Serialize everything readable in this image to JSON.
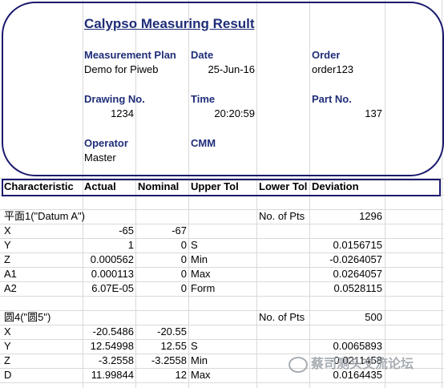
{
  "title": "Calypso Measuring Result",
  "header": {
    "measurement_plan_label": "Measurement Plan",
    "measurement_plan_value": "Demo for Piweb",
    "date_label": "Date",
    "date_value": "25-Jun-16",
    "order_label": "Order",
    "order_value": "order123",
    "drawing_no_label": "Drawing No.",
    "drawing_no_value": "1234",
    "time_label": "Time",
    "time_value": "20:20:59",
    "part_no_label": "Part No.",
    "part_no_value": "137",
    "operator_label": "Operator",
    "operator_value": "Master",
    "cmm_label": "CMM"
  },
  "columns": [
    "Characteristic",
    "Actual",
    "Nominal",
    "Upper Tol",
    "Lower Tol",
    "Deviation"
  ],
  "group1": {
    "name": "平面1(\"Datum A\")",
    "pts_label": "No. of Pts",
    "pts_value": "1296",
    "rows": [
      {
        "c": "X",
        "a": "-65",
        "n": "-67",
        "u": "",
        "d": ""
      },
      {
        "c": "Y",
        "a": "1",
        "n": "0",
        "u": "S",
        "d": "0.0156715"
      },
      {
        "c": "Z",
        "a": "0.000562",
        "n": "0",
        "u": "Min",
        "d": "-0.0264057"
      },
      {
        "c": "A1",
        "a": "0.000113",
        "n": "0",
        "u": "Max",
        "d": "0.0264057"
      },
      {
        "c": "A2",
        "a": "6.07E-05",
        "n": "0",
        "u": "Form",
        "d": "0.0528115"
      }
    ]
  },
  "group2": {
    "name": "圆4(\"圆5\")",
    "pts_label": "No. of Pts",
    "pts_value": "500",
    "rows": [
      {
        "c": "X",
        "a": "-20.5486",
        "n": "-20.55",
        "u": "",
        "d": ""
      },
      {
        "c": "Y",
        "a": "12.54998",
        "n": "12.55",
        "u": "S",
        "d": "0.0065893"
      },
      {
        "c": "Z",
        "a": "-3.2558",
        "n": "-3.2558",
        "u": "Min",
        "d": "-0.0211458"
      },
      {
        "c": "D",
        "a": "11.99844",
        "n": "12",
        "u": "Max",
        "d": "0.0164435"
      }
    ]
  },
  "watermark": "蔡司测头交流论坛"
}
